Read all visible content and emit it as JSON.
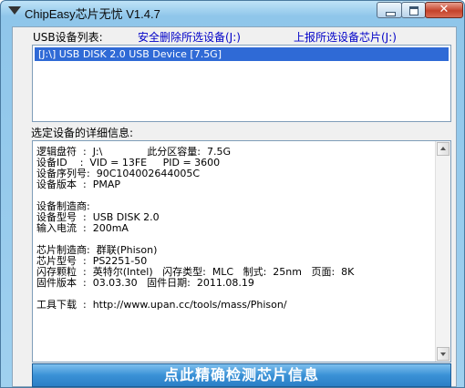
{
  "window": {
    "title": "ChipEasy芯片无忧 V1.4.7",
    "close_glyph": "✕"
  },
  "toolbar": {
    "usb_list_label": "USB设备列表:",
    "safe_remove_link": "安全删除所选设备(J:)",
    "report_chip_link": "上报所选设备芯片(J:)"
  },
  "device_list": {
    "items": [
      "[J:\\] USB DISK 2.0 USB Device [7.5G]"
    ]
  },
  "details": {
    "label": "选定设备的详细信息:",
    "lines": [
      "逻辑盘符  :  J:\\              此分区容量:  7.5G",
      "设备ID    :  VID = 13FE     PID = 3600",
      "设备序列号:  90C104002644005C",
      "设备版本  :  PMAP",
      "",
      "设备制造商:",
      "设备型号  :  USB DISK 2.0",
      "输入电流  :  200mA",
      "",
      "芯片制造商:  群联(Phison)",
      "芯片型号  :  PS2251-50",
      "闪存颗粒  :  英特尔(Intel)   闪存类型:  MLC   制式:  25nm   页面:  8K",
      "固件版本  :  03.03.30   固件日期:  2011.08.19",
      "",
      "工具下载  :  http://www.upan.cc/tools/mass/Phison/"
    ]
  },
  "check_button": {
    "label": "点此精确检测芯片信息"
  },
  "colors": {
    "selection": "#2f6ad6",
    "link": "#0000c8",
    "button": "#3a91d6"
  }
}
